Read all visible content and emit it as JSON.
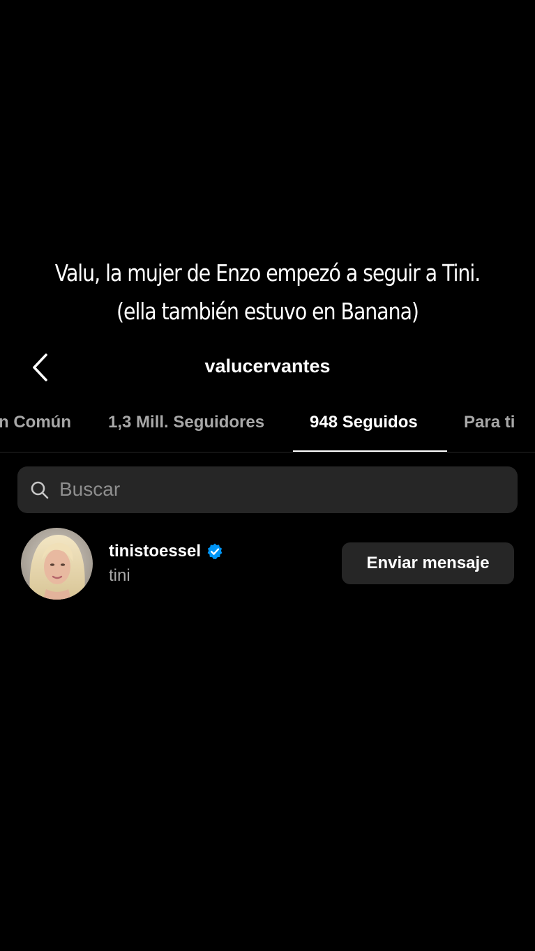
{
  "caption": {
    "line1": "Valu, la mujer de Enzo empezó a seguir a Tini.",
    "line2": "(ella también estuvo en Banana)"
  },
  "header": {
    "title": "valucervantes",
    "back_icon": "chevron-left-icon"
  },
  "tabs": [
    {
      "label": "n Común",
      "active": false
    },
    {
      "label": "1,3 Mill. Seguidores",
      "active": false
    },
    {
      "label": "948 Seguidos",
      "active": true
    },
    {
      "label": "Para ti",
      "active": false
    }
  ],
  "search": {
    "placeholder": "Buscar",
    "icon": "search-icon"
  },
  "users": [
    {
      "username": "tinistoessel",
      "full_name": "tini",
      "verified": true,
      "button_label": "Enviar mensaje"
    }
  ],
  "colors": {
    "background": "#000000",
    "surface": "#262626",
    "muted_text": "#a8a8a8",
    "placeholder_text": "#8e8e8e",
    "verified_blue": "#0095f6"
  }
}
